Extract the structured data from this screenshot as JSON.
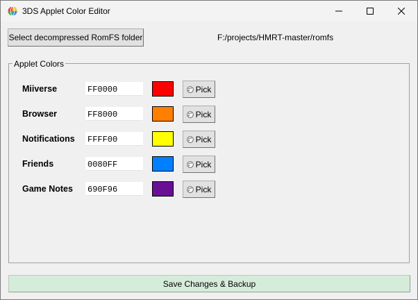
{
  "window": {
    "title": "3DS Applet Color Editor",
    "icon": "rainbow-globe-icon"
  },
  "toolbar": {
    "select_folder_label": "Select decompressed RomFS folder",
    "folder_path": "F:/projects/HMRT-master/romfs"
  },
  "group": {
    "title": "Applet Colors"
  },
  "rows": [
    {
      "label": "Miiverse",
      "hex": "FF0000",
      "color": "#FF0000",
      "pick_label": "Pick"
    },
    {
      "label": "Browser",
      "hex": "FF8000",
      "color": "#FF8000",
      "pick_label": "Pick"
    },
    {
      "label": "Notifications",
      "hex": "FFFF00",
      "color": "#FFFF00",
      "pick_label": "Pick"
    },
    {
      "label": "Friends",
      "hex": "0080FF",
      "color": "#0080FF",
      "pick_label": "Pick"
    },
    {
      "label": "Game Notes",
      "hex": "690F96",
      "color": "#690F96",
      "pick_label": "Pick"
    }
  ],
  "footer": {
    "save_label": "Save Changes & Backup"
  }
}
